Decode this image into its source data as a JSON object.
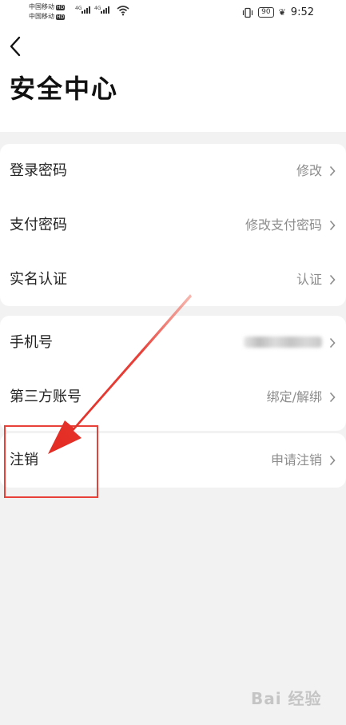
{
  "status_bar": {
    "carrier1": "中国移动",
    "carrier2": "中国移动",
    "hd": "HD",
    "net1": "4G",
    "net2": "4G",
    "battery": "90",
    "time": "9:52",
    "icons": [
      "vibrate-icon",
      "battery-icon",
      "leaf-icon",
      "wifi-icon",
      "signal-icon"
    ]
  },
  "header": {
    "back_icon": "chevron-left-icon",
    "title": "安全中心"
  },
  "groups": [
    {
      "items": [
        {
          "label": "登录密码",
          "value": "修改"
        },
        {
          "label": "支付密码",
          "value": "修改支付密码"
        },
        {
          "label": "实名认证",
          "value": "认证"
        }
      ]
    },
    {
      "items": [
        {
          "label": "手机号",
          "value": ""
        },
        {
          "label": "第三方账号",
          "value": "绑定/解绑"
        }
      ]
    },
    {
      "items": [
        {
          "label": "注销",
          "value": "申请注销"
        }
      ]
    }
  ],
  "annotation": {
    "color": "#e8413a",
    "watermark": "Bai 经验"
  }
}
